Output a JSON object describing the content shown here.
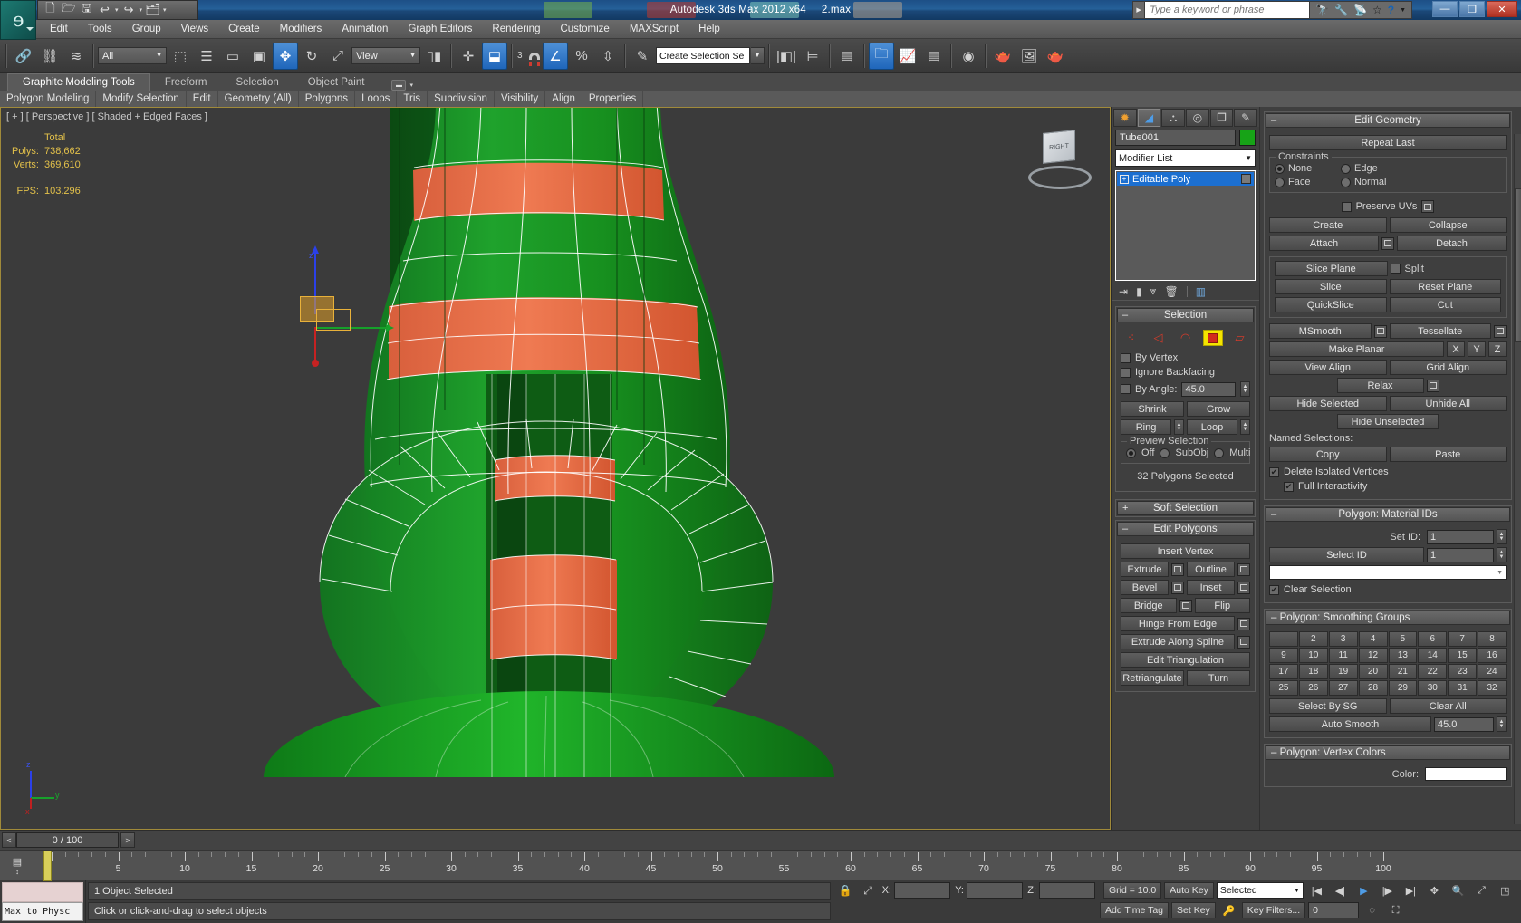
{
  "titlebar": {
    "app_title": "Autodesk 3ds Max  2012 x64",
    "file_name": "2.max",
    "search_placeholder": "Type a keyword or phrase",
    "qat": [
      "new-icon",
      "open-icon",
      "save-icon",
      "undo-icon",
      "redo-icon",
      "set-project-icon"
    ],
    "search_icons": [
      "binoculars-icon",
      "wrench-icon",
      "satellite-icon",
      "star-icon",
      "help-icon"
    ],
    "window_buttons": [
      "minimize",
      "maximize",
      "close"
    ]
  },
  "menu": {
    "items": [
      "Edit",
      "Tools",
      "Group",
      "Views",
      "Create",
      "Modifiers",
      "Animation",
      "Graph Editors",
      "Rendering",
      "Customize",
      "MAXScript",
      "Help"
    ]
  },
  "toolbar": {
    "selection_filter": "All",
    "reference_coord": "View",
    "named_set_placeholder": "Create Selection Se",
    "angle_snap_value": "3"
  },
  "ribbon": {
    "tabs": [
      {
        "label": "Graphite Modeling Tools",
        "active": true
      },
      {
        "label": "Freeform",
        "active": false
      },
      {
        "label": "Selection",
        "active": false
      },
      {
        "label": "Object Paint",
        "active": false
      }
    ],
    "subtabs": [
      "Polygon Modeling",
      "Modify Selection",
      "Edit",
      "Geometry (All)",
      "Polygons",
      "Loops",
      "Tris",
      "Subdivision",
      "Visibility",
      "Align",
      "Properties"
    ]
  },
  "viewport": {
    "label": "[ + ] [ Perspective ] [ Shaded + Edged Faces ]",
    "stats": {
      "header": "Total",
      "polys_label": "Polys:",
      "polys_value": "738,662",
      "verts_label": "Verts:",
      "verts_value": "369,610",
      "fps_label": "FPS:",
      "fps_value": "103.296"
    },
    "viewcube_face": "RIGHT",
    "axis_labels": {
      "x": "x",
      "y": "y",
      "z": "z"
    },
    "tripod_labels": {
      "x": "x",
      "y": "y",
      "z": "z"
    }
  },
  "command_panel": {
    "tabs": [
      "create-tab",
      "modify-tab",
      "hierarchy-tab",
      "motion-tab",
      "display-tab",
      "utilities-tab"
    ],
    "object_name": "Tube001",
    "object_color": "#17a317",
    "modifier_list_label": "Modifier List",
    "stack": [
      {
        "label": "Editable Poly",
        "selected": true
      }
    ],
    "selection_rollout": {
      "title": "Selection",
      "sub_object_modes": [
        "vertex",
        "edge",
        "border",
        "polygon",
        "element"
      ],
      "active_mode": "polygon",
      "by_vertex": "By Vertex",
      "ignore_backfacing": "Ignore Backfacing",
      "by_angle": "By Angle:",
      "by_angle_value": "45.0",
      "shrink": "Shrink",
      "grow": "Grow",
      "ring": "Ring",
      "loop": "Loop",
      "preview_selection": "Preview Selection",
      "preview_options": [
        "Off",
        "SubObj",
        "Multi"
      ],
      "preview_active": "Off",
      "status": "32 Polygons Selected"
    },
    "soft_selection_rollout": {
      "title": "Soft Selection",
      "collapsed": true
    },
    "edit_polygons_rollout": {
      "title": "Edit Polygons",
      "insert_vertex": "Insert Vertex",
      "extrude": "Extrude",
      "outline": "Outline",
      "bevel": "Bevel",
      "inset": "Inset",
      "bridge": "Bridge",
      "flip": "Flip",
      "hinge_from_edge": "Hinge From Edge",
      "extrude_along_spline": "Extrude Along Spline",
      "edit_triangulation": "Edit Triangulation",
      "retriangulate": "Retriangulate",
      "turn": "Turn"
    },
    "edit_geometry_rollout": {
      "title": "Edit Geometry",
      "repeat_last": "Repeat Last",
      "constraints_label": "Constraints",
      "constraints": [
        "None",
        "Edge",
        "Face",
        "Normal"
      ],
      "constraints_active": "None",
      "preserve_uvs": "Preserve UVs",
      "create": "Create",
      "collapse": "Collapse",
      "attach": "Attach",
      "detach": "Detach",
      "slice_plane": "Slice Plane",
      "split": "Split",
      "slice": "Slice",
      "reset_plane": "Reset Plane",
      "quickslice": "QuickSlice",
      "cut": "Cut",
      "msmooth": "MSmooth",
      "tessellate": "Tessellate",
      "make_planar": "Make Planar",
      "axis_x": "X",
      "axis_y": "Y",
      "axis_z": "Z",
      "view_align": "View Align",
      "grid_align": "Grid Align",
      "relax": "Relax",
      "hide_selected": "Hide Selected",
      "unhide_all": "Unhide All",
      "hide_unselected": "Hide Unselected",
      "named_selections": "Named Selections:",
      "copy": "Copy",
      "paste": "Paste",
      "delete_isolated_vertices": "Delete Isolated Vertices",
      "full_interactivity": "Full Interactivity"
    },
    "material_ids_rollout": {
      "title": "Polygon: Material IDs",
      "set_id_label": "Set ID:",
      "set_id_value": "1",
      "select_id_label": "Select ID",
      "select_id_value": "1",
      "clear_selection": "Clear Selection"
    },
    "smoothing_groups_rollout": {
      "title": "Polygon: Smoothing Groups",
      "groups": [
        "",
        "2",
        "3",
        "4",
        "5",
        "6",
        "7",
        "8",
        "9",
        "10",
        "11",
        "12",
        "13",
        "14",
        "15",
        "16",
        "17",
        "18",
        "19",
        "20",
        "21",
        "22",
        "23",
        "24",
        "25",
        "26",
        "27",
        "28",
        "29",
        "30",
        "31",
        "32"
      ],
      "select_by_sg": "Select By SG",
      "clear_all": "Clear All",
      "auto_smooth": "Auto Smooth",
      "auto_smooth_value": "45.0"
    },
    "vertex_colors_rollout": {
      "title": "Polygon: Vertex Colors",
      "color_label": "Color:"
    }
  },
  "timebar": {
    "current_frame": "0 / 100",
    "prev_label": "<",
    "next_label": ">",
    "ticks": [
      "5",
      "10",
      "15",
      "20",
      "25",
      "30",
      "35",
      "40",
      "45",
      "50",
      "55",
      "60",
      "65",
      "70",
      "75",
      "80",
      "85",
      "90",
      "95",
      "100"
    ]
  },
  "statusbar": {
    "max_to_physical": "Max to Physc",
    "selection_status": "1 Object Selected",
    "prompt": "Click or click-and-drag to select objects",
    "coords": {
      "x_label": "X:",
      "x_value": "",
      "y_label": "Y:",
      "y_value": "",
      "z_label": "Z:",
      "z_value": ""
    },
    "grid": "Grid = 10.0",
    "add_time_tag": "Add Time Tag",
    "auto_key": "Auto Key",
    "set_key": "Set Key",
    "key_filters": "Key Filters...",
    "selected_mode": "Selected",
    "frame_value": "0"
  }
}
